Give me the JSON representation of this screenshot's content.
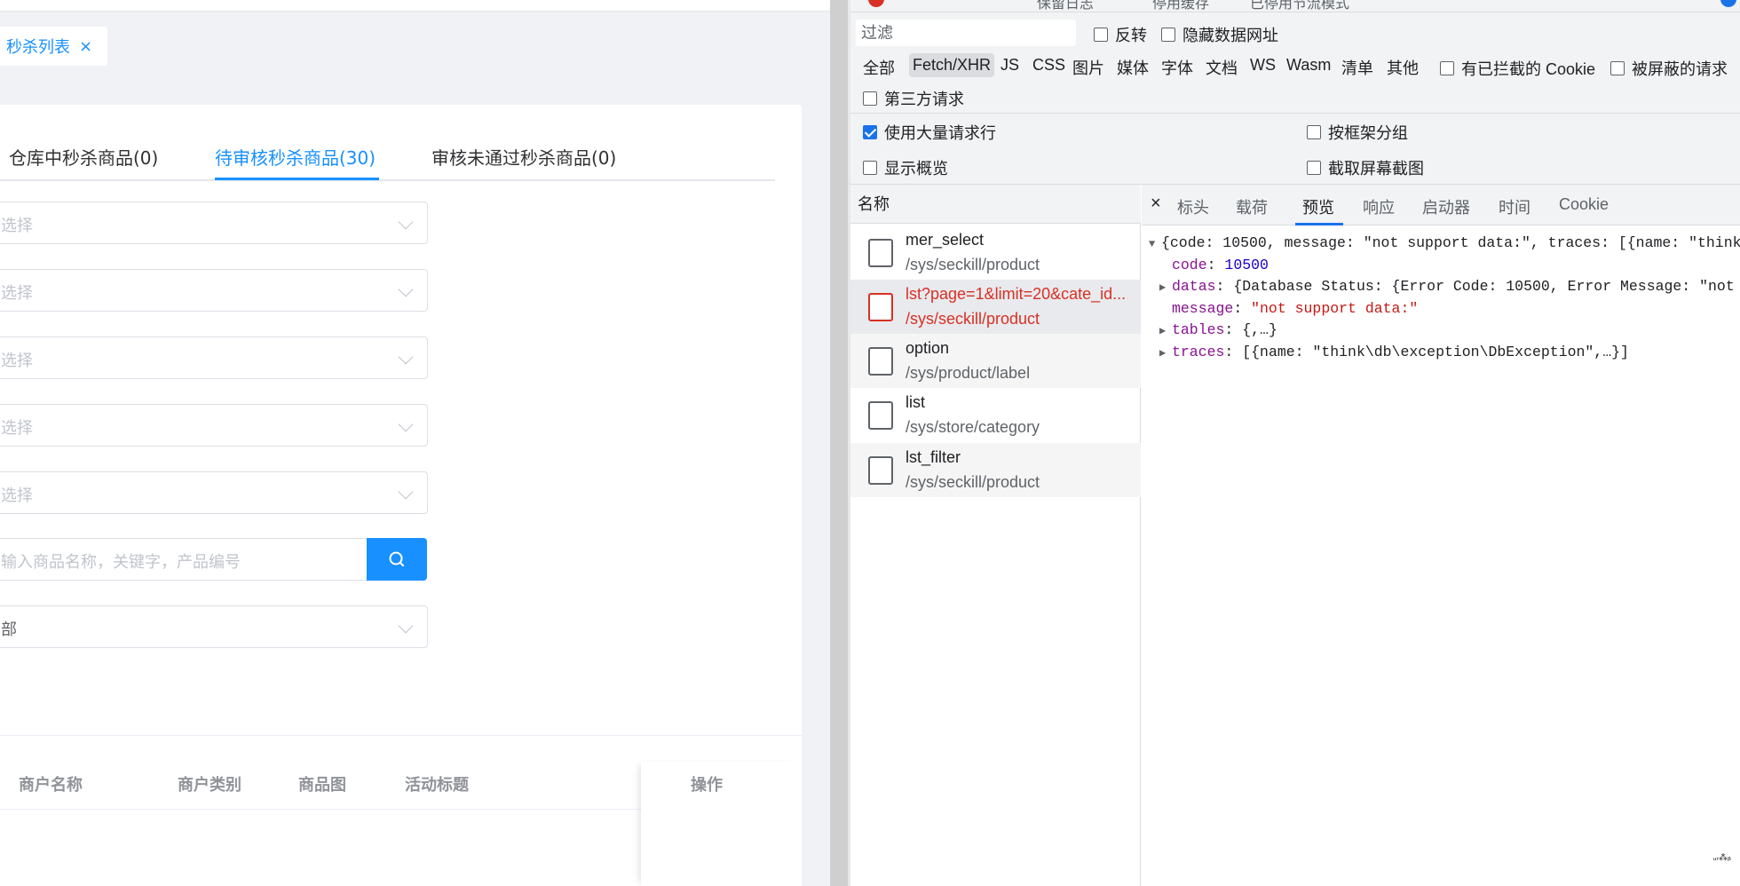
{
  "app": {
    "tag": {
      "label": "秒杀列表",
      "close": "×"
    },
    "tabs": [
      {
        "label": "仓库中秒杀商品(0)"
      },
      {
        "label": "待审核秒杀商品(30)"
      },
      {
        "label": "审核未通过秒杀商品(0)"
      }
    ],
    "selects": [
      {
        "placeholder": "选择"
      },
      {
        "placeholder": "选择"
      },
      {
        "placeholder": "选择"
      },
      {
        "placeholder": "选择"
      },
      {
        "placeholder": "选择"
      }
    ],
    "search": {
      "placeholder": "输入商品名称，关键字，产品编号"
    },
    "status_select": {
      "value": "部"
    },
    "table": {
      "headers": [
        "商户名称",
        "商户类别",
        "商品图",
        "活动标题"
      ],
      "fixed_header": "操作"
    }
  },
  "devtools": {
    "toolbar": {
      "cut1": "保留日志",
      "cut2": "停用缓存",
      "cut3": "已停用节流模式"
    },
    "filter": {
      "placeholder": "过滤"
    },
    "checks_row1": [
      {
        "label": "反转",
        "checked": false
      },
      {
        "label": "隐藏数据网址",
        "checked": false
      }
    ],
    "types": [
      "全部",
      "Fetch/XHR",
      "JS",
      "CSS",
      "图片",
      "媒体",
      "字体",
      "文档",
      "WS",
      "Wasm",
      "清单",
      "其他"
    ],
    "checks_row2": [
      {
        "label": "有已拦截的 Cookie",
        "checked": false
      },
      {
        "label": "被屏蔽的请求",
        "checked": false
      },
      {
        "label": "第三方请求",
        "checked": false
      }
    ],
    "options": [
      {
        "label": "使用大量请求行",
        "checked": true
      },
      {
        "label": "按框架分组",
        "checked": false
      },
      {
        "label": "显示概览",
        "checked": false
      },
      {
        "label": "截取屏幕截图",
        "checked": false
      }
    ],
    "list_header": "名称",
    "requests": [
      {
        "name": "mer_select",
        "path": "/sys/seckill/product",
        "error": false
      },
      {
        "name": "lst?page=1&limit=20&cate_id...",
        "path": "/sys/seckill/product",
        "error": true
      },
      {
        "name": "option",
        "path": "/sys/product/label",
        "error": false
      },
      {
        "name": "list",
        "path": "/sys/store/category",
        "error": false
      },
      {
        "name": "lst_filter",
        "path": "/sys/seckill/product",
        "error": false
      }
    ],
    "detail_close": "×",
    "detail_tabs": [
      "标头",
      "载荷",
      "预览",
      "响应",
      "启动器",
      "时间",
      "Cookie"
    ],
    "preview": {
      "summary": "{code: 10500, message: \"not support data:\", traces: [{name: \"think",
      "code_key": "code",
      "code_val": "10500",
      "datas_key": "datas",
      "datas_val": "{Database Status: {Error Code: 10500, Error Message: \"not",
      "message_key": "message",
      "message_val": "\"not support data:\"",
      "tables_key": "tables",
      "tables_val": "{,…}",
      "traces_key": "traces",
      "traces_val": "[{name: \"think\\db\\exception\\DbException\",…}]"
    },
    "corner_mark": "ᵤᵣ⁂ᵦ"
  }
}
